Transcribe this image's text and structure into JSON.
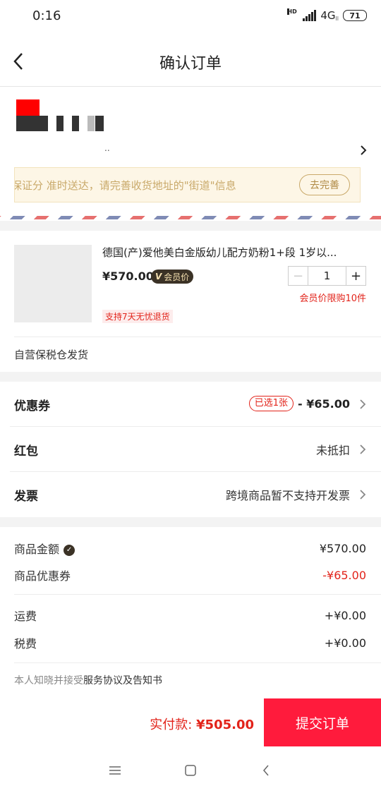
{
  "status_bar": {
    "time": "0:16",
    "network": "4G",
    "network_sub": "ll",
    "hd": "HD",
    "battery": "71"
  },
  "nav": {
    "title": "确认订单"
  },
  "address": {
    "dots": "..",
    "notice_text": "为保证分 准时送达，请完善收货地址的\"街道\"信息",
    "notice_button": "去完善"
  },
  "product": {
    "name": "德国(产)爱他美白金版幼儿配方奶粉1+段 1岁以...",
    "price": "¥570.00",
    "member_badge_v": "V",
    "member_badge": "会员价",
    "quantity": "1",
    "minus": "−",
    "plus": "+",
    "limit": "会员价限购10件",
    "return_tag": "支持7天无忧退货",
    "shipping": "自营保税仓发货"
  },
  "rows": {
    "coupon": {
      "label": "优惠券",
      "tag": "已选1张",
      "amount": "- ¥65.00"
    },
    "redpacket": {
      "label": "红包",
      "value": "未抵扣"
    },
    "invoice": {
      "label": "发票",
      "value": "跨境商品暂不支持开发票"
    }
  },
  "summary": {
    "goods_label": "商品金额",
    "goods_value": "¥570.00",
    "coupon_label": "商品优惠券",
    "coupon_value": "-¥65.00",
    "freight_label": "运费",
    "freight_value": "+¥0.00",
    "tax_label": "税费",
    "tax_value": "+¥0.00",
    "agree_prefix": "本人知晓并接受",
    "agree_link": "服务协议及告知书"
  },
  "bottom": {
    "pay_label": "实付款:",
    "pay_amount": "¥505.00",
    "submit": "提交订单"
  },
  "colors": {
    "accent_red": "#e2231a",
    "submit_bg": "#ff1b3c",
    "notice_bg": "#fdf6e6",
    "badge_bg": "#3b3226"
  }
}
